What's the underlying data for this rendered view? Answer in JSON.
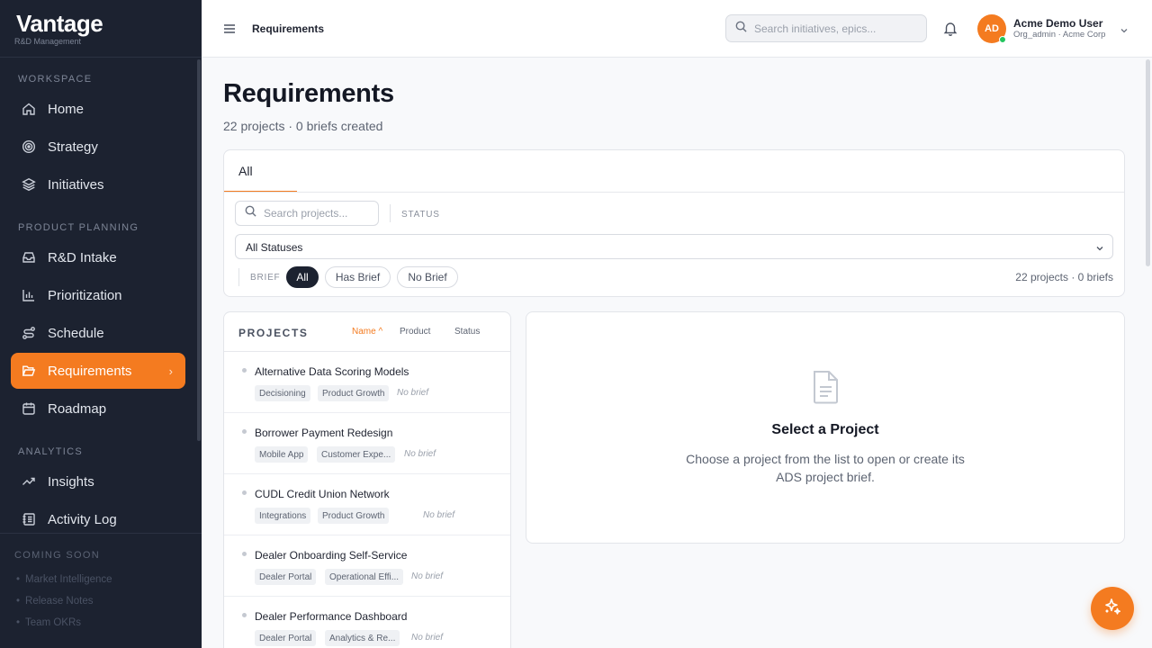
{
  "brand": {
    "name": "Vantage",
    "subtitle": "R&D Management"
  },
  "sidebar": {
    "sections": [
      {
        "label": "WORKSPACE"
      },
      {
        "label": "PRODUCT PLANNING"
      },
      {
        "label": "ANALYTICS"
      }
    ],
    "items": [
      {
        "label": "Home",
        "icon": "home-icon"
      },
      {
        "label": "Strategy",
        "icon": "target-icon"
      },
      {
        "label": "Initiatives",
        "icon": "layers-icon"
      },
      {
        "label": "R&D Intake",
        "icon": "inbox-icon"
      },
      {
        "label": "Prioritization",
        "icon": "bar-chart-icon"
      },
      {
        "label": "Schedule",
        "icon": "route-icon"
      },
      {
        "label": "Requirements",
        "icon": "folder-open-icon",
        "active": true
      },
      {
        "label": "Roadmap",
        "icon": "calendar-icon"
      },
      {
        "label": "Insights",
        "icon": "trending-up-icon"
      },
      {
        "label": "Activity Log",
        "icon": "log-icon"
      }
    ],
    "coming_soon": {
      "label": "COMING SOON",
      "items": [
        "Market Intelligence",
        "Release Notes",
        "Team OKRs"
      ]
    }
  },
  "topbar": {
    "breadcrumb": "Requirements",
    "search_placeholder": "Search initiatives, epics...",
    "user": {
      "initials": "AD",
      "name": "Acme Demo User",
      "role": "Org_admin · Acme Corp"
    }
  },
  "page": {
    "title": "Requirements",
    "subtitle": "22 projects · 0 briefs created"
  },
  "filters": {
    "tab": "All",
    "search_placeholder": "Search projects...",
    "status_label": "STATUS",
    "status_value": "All Statuses",
    "brief_label": "BRIEF",
    "brief_options": [
      "All",
      "Has Brief",
      "No Brief"
    ],
    "brief_selected": "All",
    "counts": "22 projects · 0 briefs"
  },
  "projects": {
    "title": "PROJECTS",
    "sort": {
      "name": "Name ^",
      "product": "Product",
      "status": "Status"
    },
    "rows": [
      {
        "name": "Alternative Data Scoring Models",
        "tags": [
          "Decisioning",
          "Product Growth"
        ],
        "brief": "No brief"
      },
      {
        "name": "Borrower Payment Redesign",
        "tags": [
          "Mobile App",
          "Customer Expe..."
        ],
        "brief": "No brief"
      },
      {
        "name": "CUDL Credit Union Network",
        "tags": [
          "Integrations",
          "Product Growth"
        ],
        "brief": "No brief"
      },
      {
        "name": "Dealer Onboarding Self-Service",
        "tags": [
          "Dealer Portal",
          "Operational Effi..."
        ],
        "brief": "No brief"
      },
      {
        "name": "Dealer Performance Dashboard",
        "tags": [
          "Dealer Portal",
          "Analytics & Re..."
        ],
        "brief": "No brief"
      }
    ]
  },
  "detail": {
    "title": "Select a Project",
    "description": "Choose a project from the list to open or create its ADS project brief."
  },
  "colors": {
    "accent": "#f47b20",
    "sidebar_bg": "#1c2230",
    "online": "#22c55e"
  }
}
